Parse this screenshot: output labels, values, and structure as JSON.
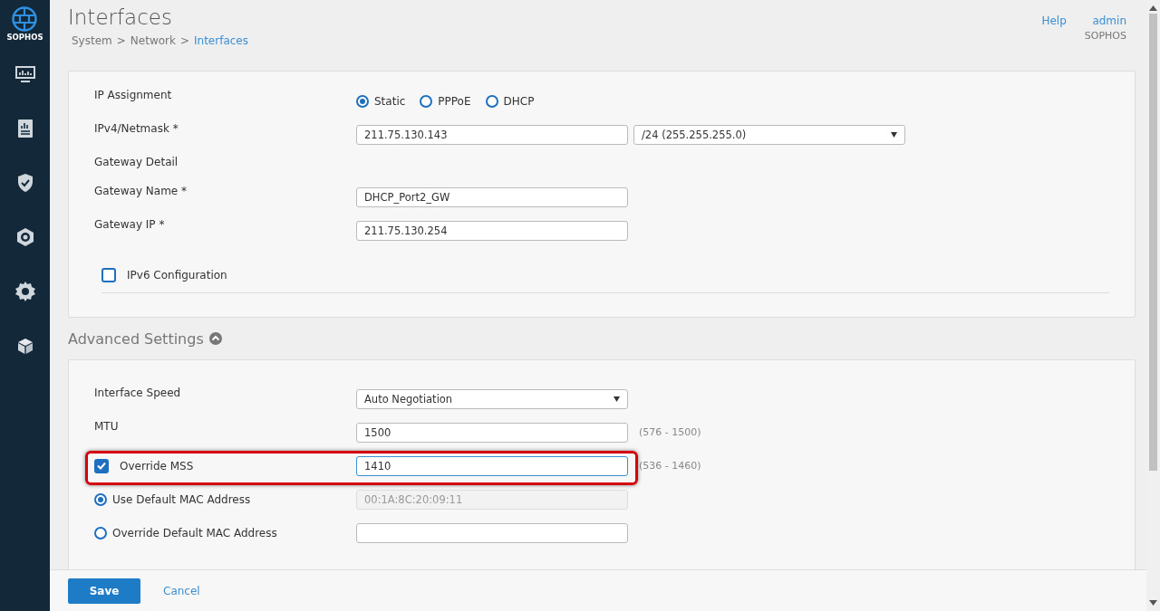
{
  "sidebar": {
    "logo_text": "SOPHOS"
  },
  "header": {
    "title": "Interfaces",
    "breadcrumb": [
      {
        "label": "System",
        "current": false
      },
      {
        "label": "Network",
        "current": false
      },
      {
        "label": "Interfaces",
        "current": true
      }
    ],
    "separator": ">",
    "help": "Help",
    "user": "admin",
    "org": "SOPHOS"
  },
  "ip_section": {
    "rows": [
      {
        "kind": "radio-group",
        "label": "IP Assignment",
        "options": [
          {
            "label": "Static",
            "selected": true
          },
          {
            "label": "PPPoE",
            "selected": false
          },
          {
            "label": "DHCP",
            "selected": false
          }
        ]
      },
      {
        "kind": "input-select",
        "label": "IPv4/Netmask *",
        "value": "211.75.130.143",
        "select": "/24 (255.255.255.0)"
      },
      {
        "kind": "heading",
        "label": "Gateway Detail"
      },
      {
        "kind": "input",
        "label": "Gateway Name *",
        "value": "DHCP_Port2_GW"
      },
      {
        "kind": "input",
        "label": "Gateway IP *",
        "value": "211.75.130.254"
      }
    ],
    "ipv6": {
      "label": "IPv6 Configuration",
      "checked": false
    }
  },
  "advanced": {
    "title": "Advanced Settings",
    "expanded": true,
    "rows": [
      {
        "kind": "select",
        "label": "Interface Speed",
        "value": "Auto Negotiation"
      },
      {
        "kind": "input",
        "label": "MTU",
        "value": "1500",
        "hint": "(576 - 1500)"
      },
      {
        "kind": "checkbox-input",
        "label": "Override MSS",
        "checked": true,
        "value": "1410",
        "hint": "(536 - 1460)",
        "highlighted": true,
        "focused": true
      },
      {
        "kind": "radio-input",
        "label": "Use Default MAC Address",
        "selected": true,
        "value": "00:1A:8C:20:09:11",
        "disabled": true
      },
      {
        "kind": "radio-input",
        "label": "Override Default MAC Address",
        "selected": false,
        "disabled": false
      }
    ]
  },
  "footer": {
    "save": "Save",
    "cancel": "Cancel"
  }
}
